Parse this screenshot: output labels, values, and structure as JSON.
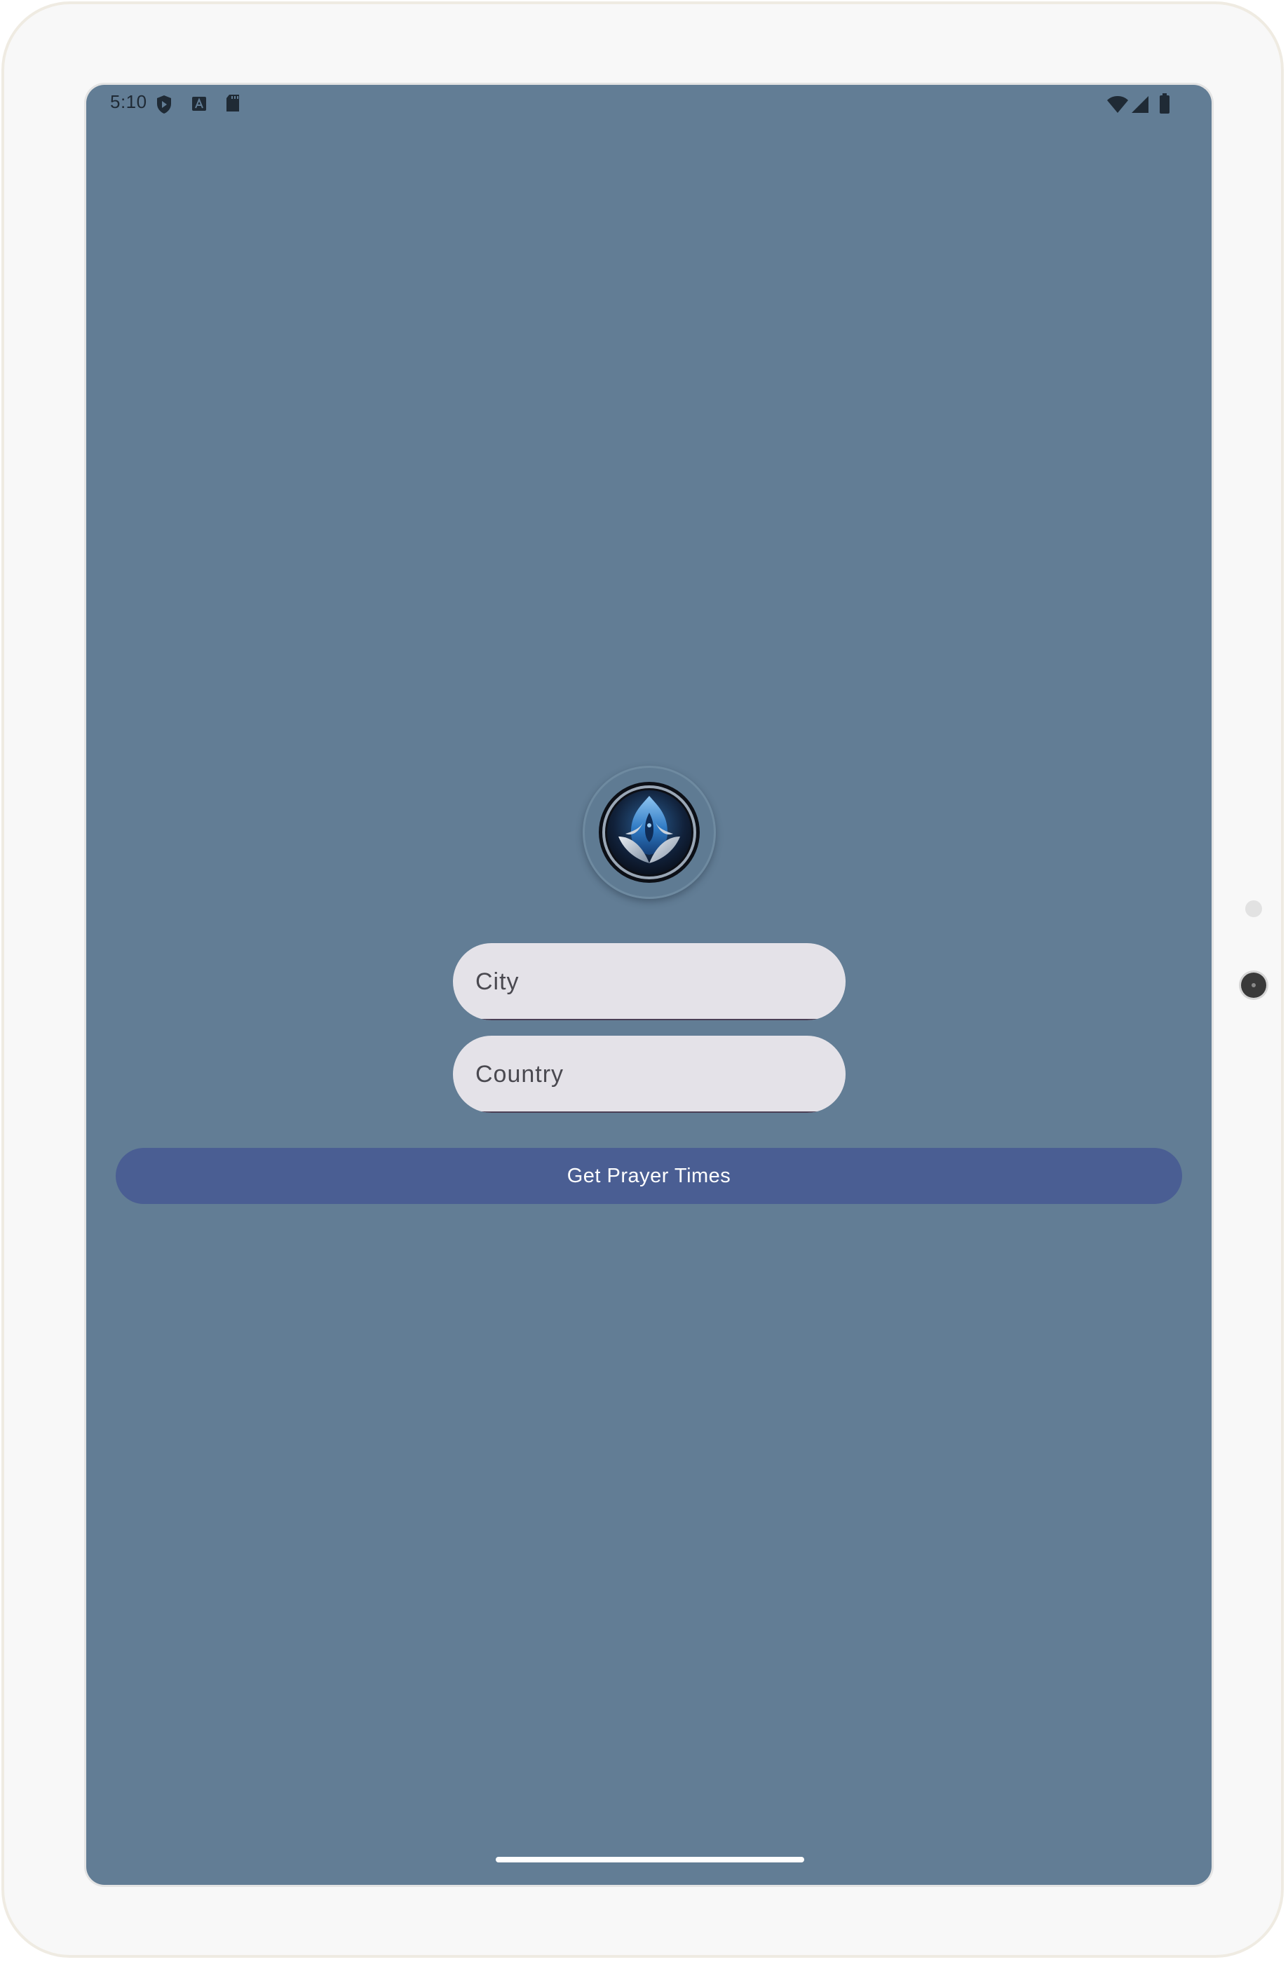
{
  "status_bar": {
    "time": "5:10",
    "left_icons": [
      "play-protect-icon",
      "font-a-icon",
      "sd-card-icon"
    ],
    "right_icons": [
      "wifi-icon",
      "cellular-signal-icon",
      "battery-icon"
    ]
  },
  "app": {
    "logo_icon": "mosque-dome-logo-icon",
    "city_field": {
      "placeholder": "City",
      "value": ""
    },
    "country_field": {
      "placeholder": "Country",
      "value": ""
    },
    "submit_label": "Get Prayer Times"
  },
  "colors": {
    "background": "#627d95",
    "field_fill": "#e4e2e8",
    "button": "#4a5e93",
    "button_text": "#ffffff"
  }
}
